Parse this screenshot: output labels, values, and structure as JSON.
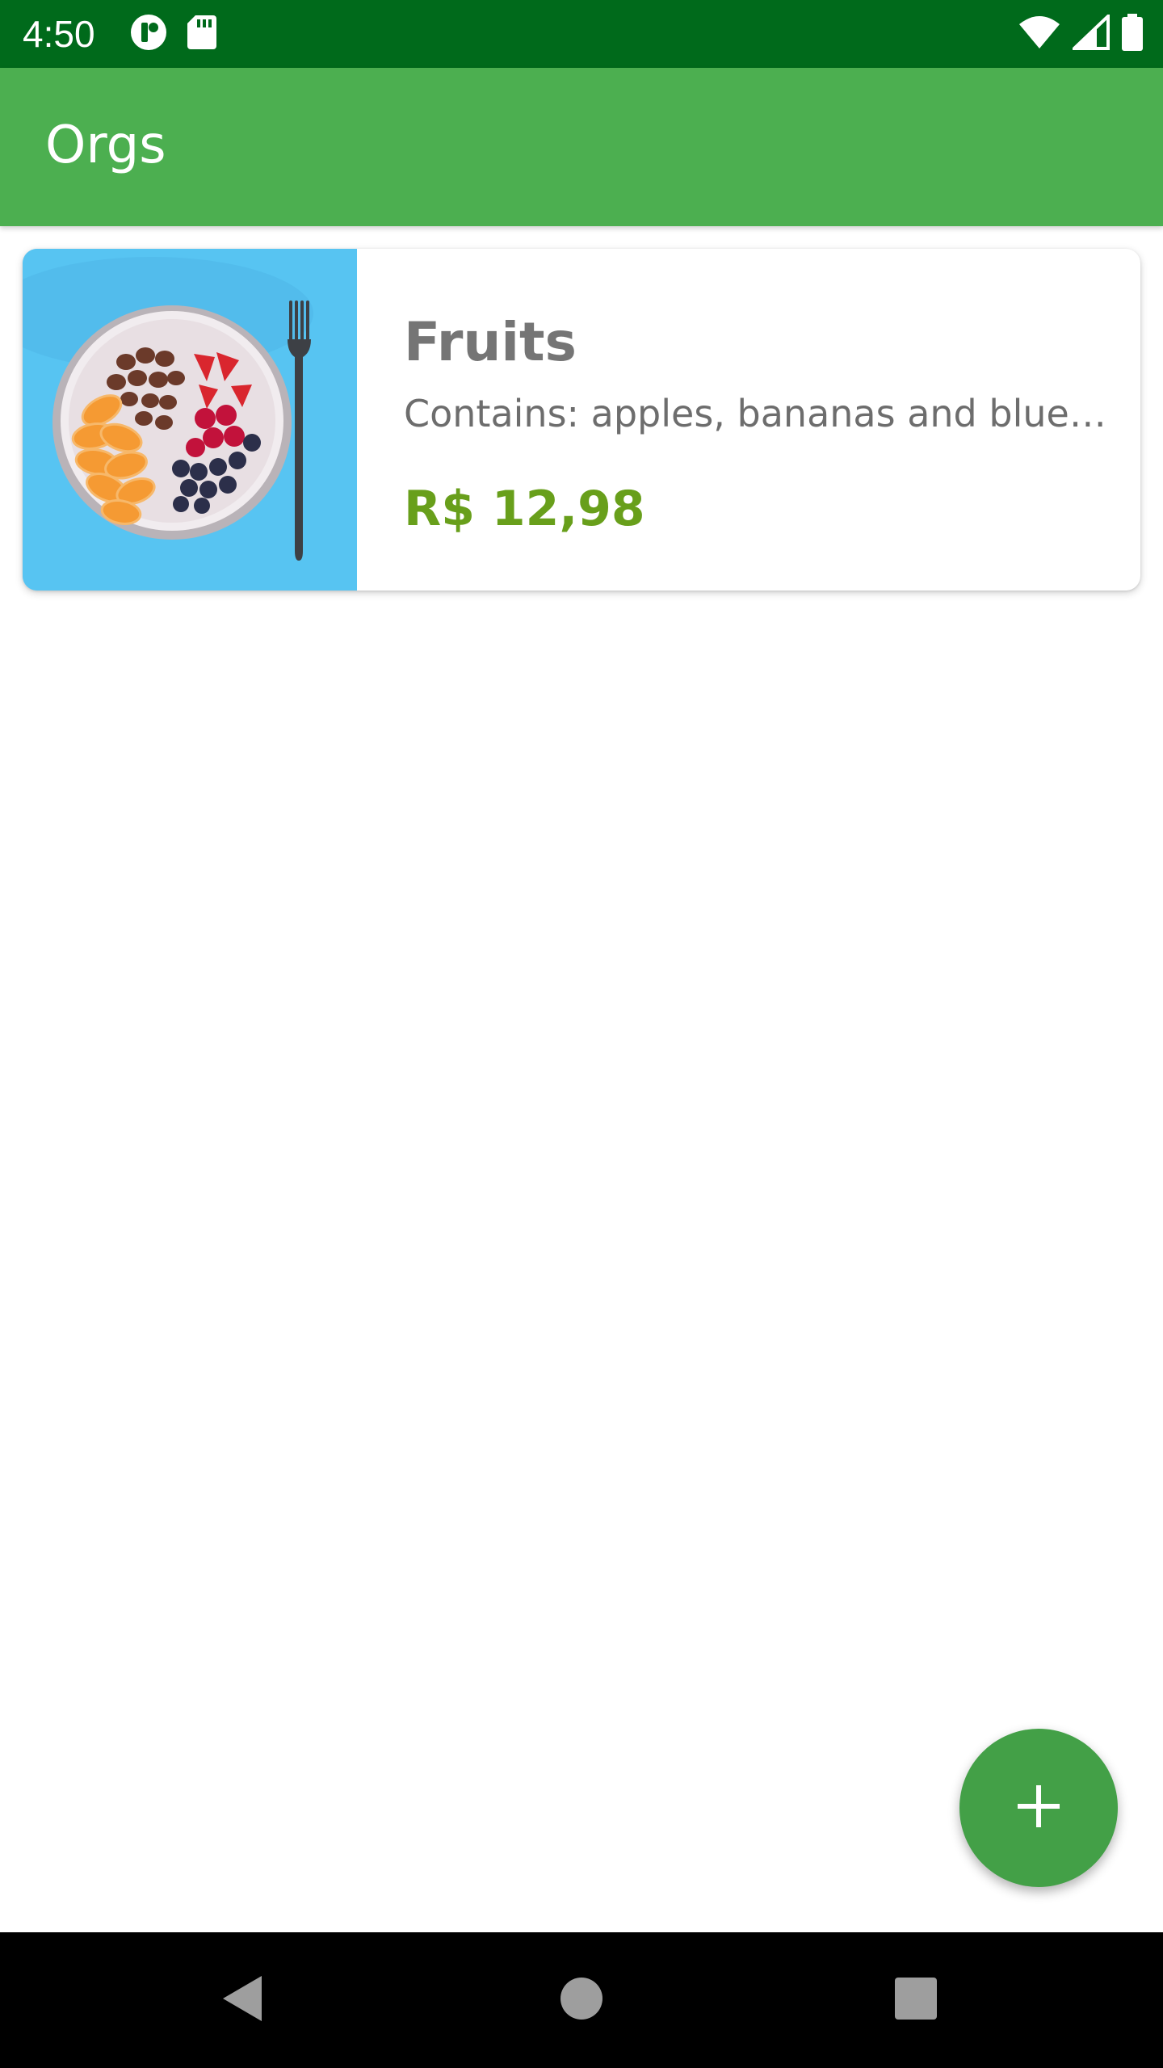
{
  "status_bar": {
    "time": "4:50",
    "left_icons": [
      "notification-app-icon",
      "sd-card-icon"
    ],
    "right_icons": [
      "wifi-icon",
      "cell-signal-icon",
      "battery-icon"
    ]
  },
  "app_bar": {
    "title": "Orgs"
  },
  "products": [
    {
      "name": "Fruits",
      "description": "Contains: apples, bananas and blueberries",
      "price": "R$ 12,98",
      "image_icon": "fruit-bowl-image"
    }
  ],
  "fab": {
    "icon": "add-icon"
  },
  "nav_bar": {
    "buttons": [
      "back-icon",
      "home-icon",
      "recents-icon"
    ]
  },
  "colors": {
    "status_bar": "#006a1b",
    "app_bar": "#4caf50",
    "fab": "#43a047",
    "price": "#689f1b",
    "image_background": "#57c4f2"
  }
}
